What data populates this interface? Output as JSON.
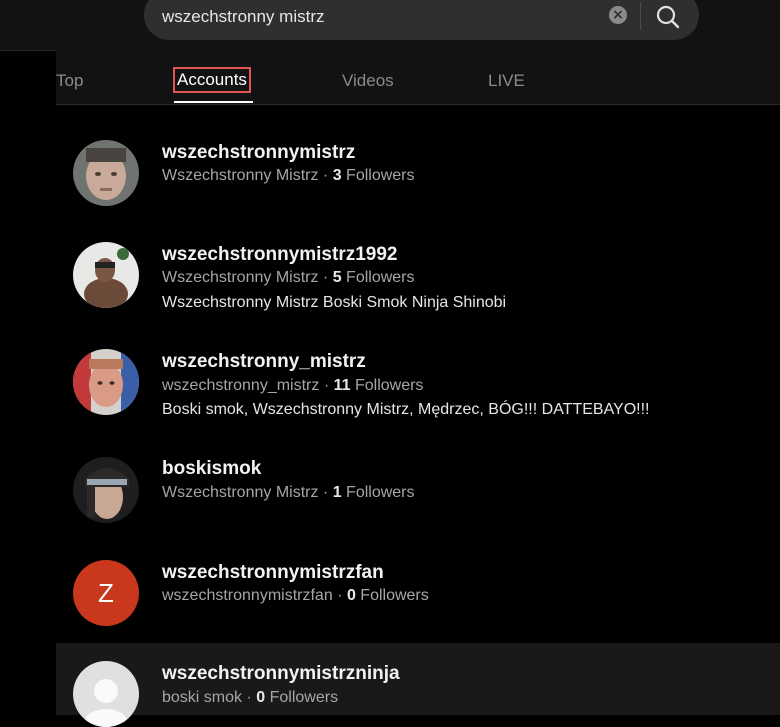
{
  "search": {
    "value": "wszechstronny mistrz",
    "clear_label": "×"
  },
  "tabs": [
    {
      "label": "Top"
    },
    {
      "label": "Accounts"
    },
    {
      "label": "Videos"
    },
    {
      "label": "LIVE"
    }
  ],
  "accounts": [
    {
      "username": "wszechstronnymistrz",
      "display_name": "Wszechstronny Mistrz",
      "followers_count": "3",
      "followers_label": "Followers",
      "bio": ""
    },
    {
      "username": "wszechstronnymistrz1992",
      "display_name": "Wszechstronny Mistrz",
      "followers_count": "5",
      "followers_label": "Followers",
      "bio": "Wszechstronny Mistrz Boski Smok Ninja Shinobi"
    },
    {
      "username": "wszechstronny_mistrz",
      "display_name": "wszechstronny_mistrz",
      "followers_count": "11",
      "followers_label": "Followers",
      "bio": "Boski smok, Wszechstronny Mistrz, Mędrzec, BÓG!!! DATTEBAYO!!!"
    },
    {
      "username": "boskismok",
      "display_name": "Wszechstronny Mistrz",
      "followers_count": "1",
      "followers_label": "Followers",
      "bio": ""
    },
    {
      "username": "wszechstronnymistrzfan",
      "display_name": "wszechstronnymistrzfan",
      "followers_count": "0",
      "followers_label": "Followers",
      "bio": "",
      "avatar_letter": "Z"
    },
    {
      "username": "wszechstronnymistrzninja",
      "display_name": "boski smok",
      "followers_count": "0",
      "followers_label": "Followers",
      "bio": ""
    }
  ],
  "colors": {
    "active_tab_outline": "#e05555",
    "letter_avatar_bg": "#c9371c"
  }
}
